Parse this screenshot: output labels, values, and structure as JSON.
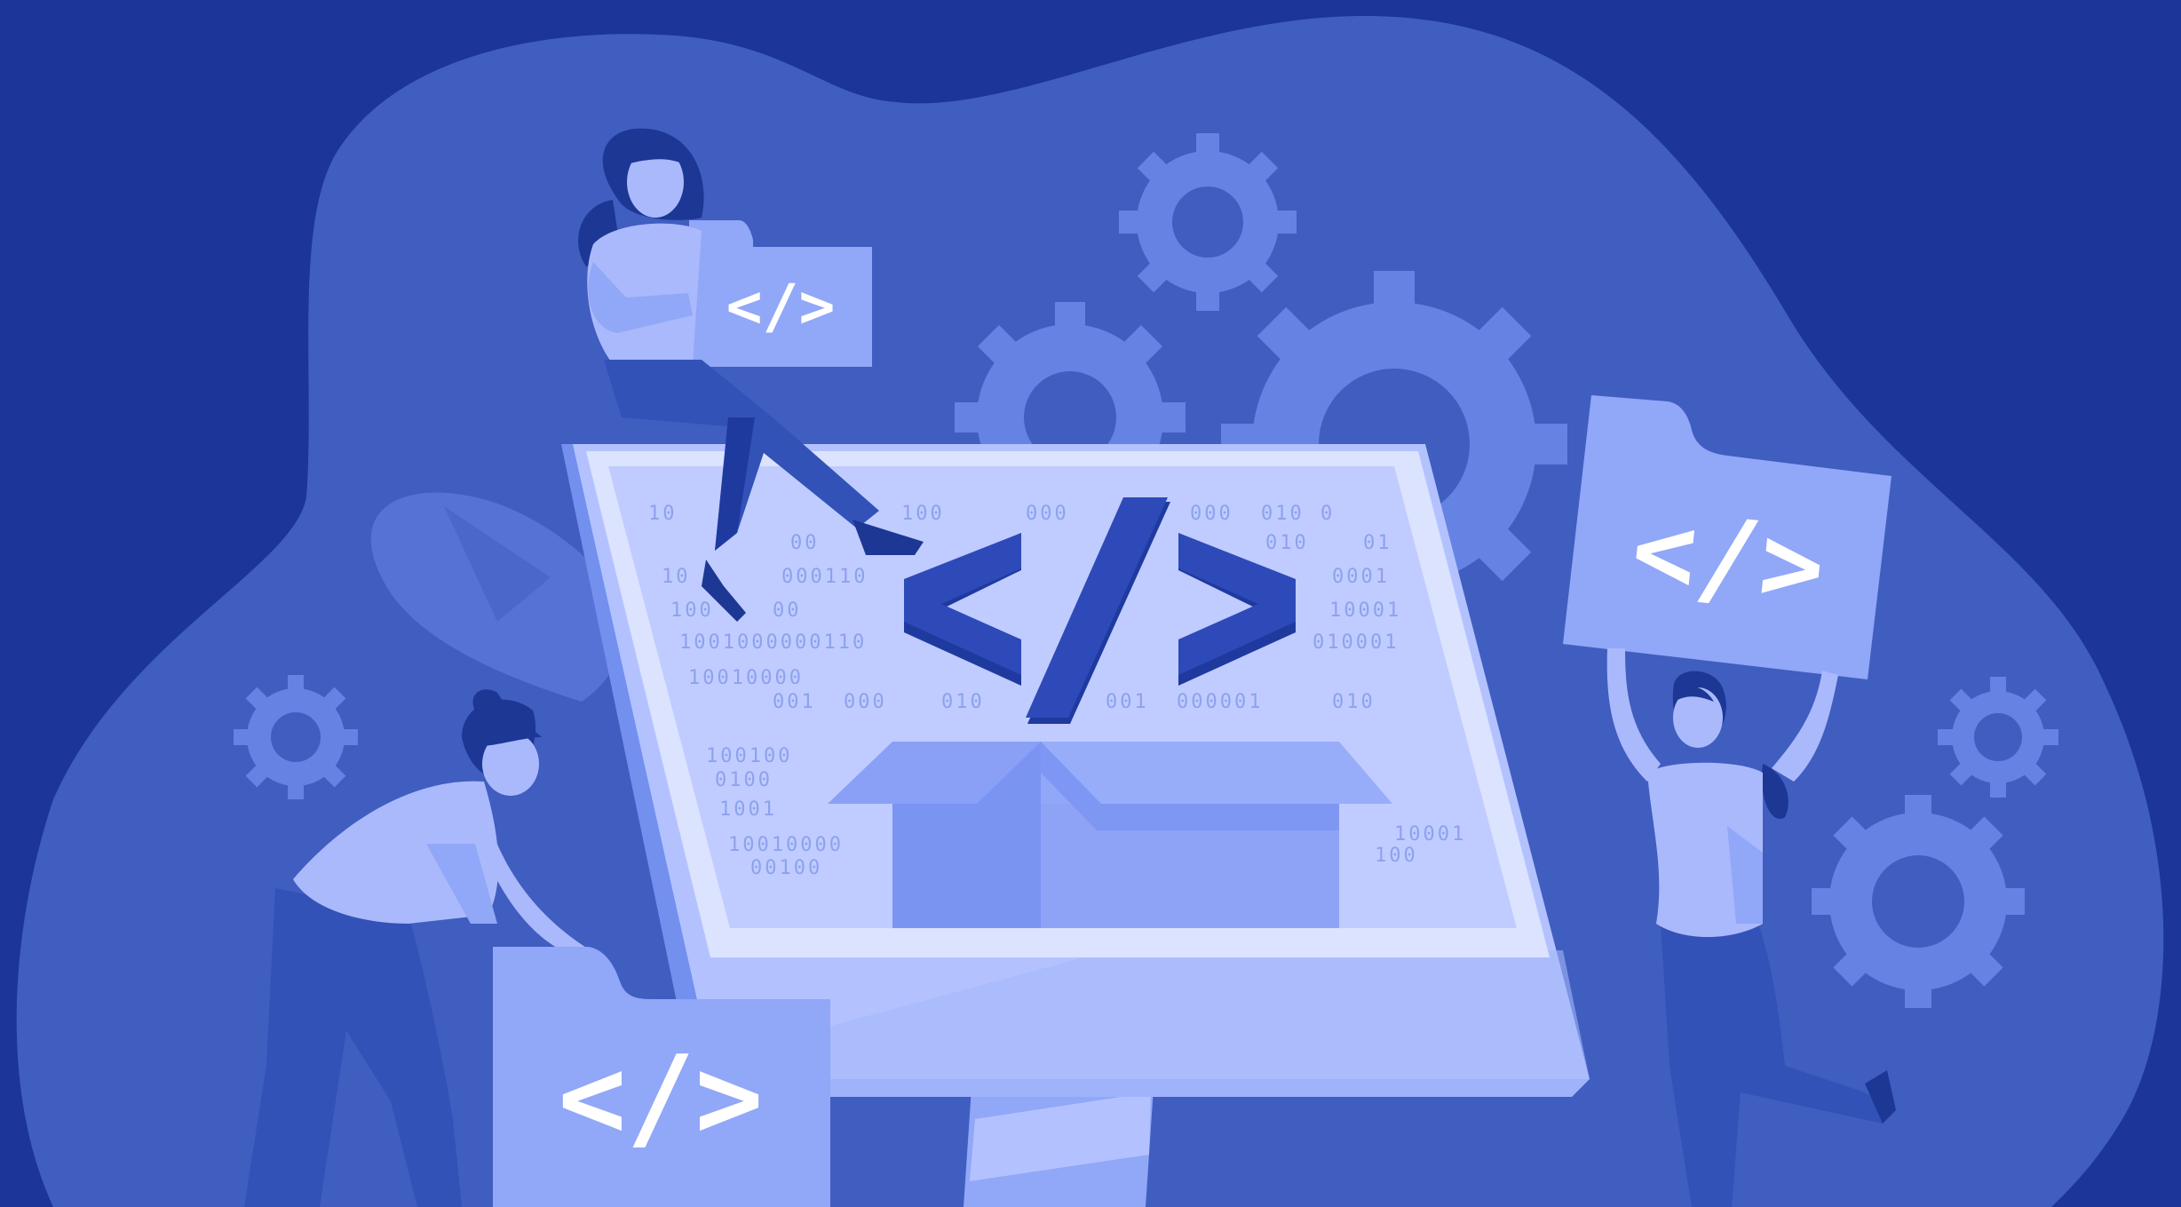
{
  "illustration": {
    "colors": {
      "background": "#1b3599",
      "blob": "#405dc0",
      "gear_light": "#6583e2",
      "gear_mid": "#5470d3",
      "panel": "#91a7f7",
      "screen": "#c0ccff",
      "screen_border": "#dce3ff",
      "code_dark": "#1f3a9f",
      "skin": "#aab9fb",
      "hair": "#1c3794",
      "pants": "#3252b8",
      "white": "#ffffff"
    },
    "code_symbol": "</>",
    "folder_labels": [
      "</>",
      "</>",
      "</>"
    ],
    "binary_digits": [
      "10",
      "100",
      "000",
      "000",
      "010",
      "0",
      "00",
      "010",
      "01",
      "10",
      "000110",
      "0001",
      "100",
      "00",
      "10001",
      "1001000000110",
      "010001",
      "10010000",
      "001",
      "000",
      "010",
      "001",
      "000001",
      "010",
      "100100",
      "0100",
      "1001",
      "10010000",
      "00100",
      "10001",
      "100"
    ]
  }
}
